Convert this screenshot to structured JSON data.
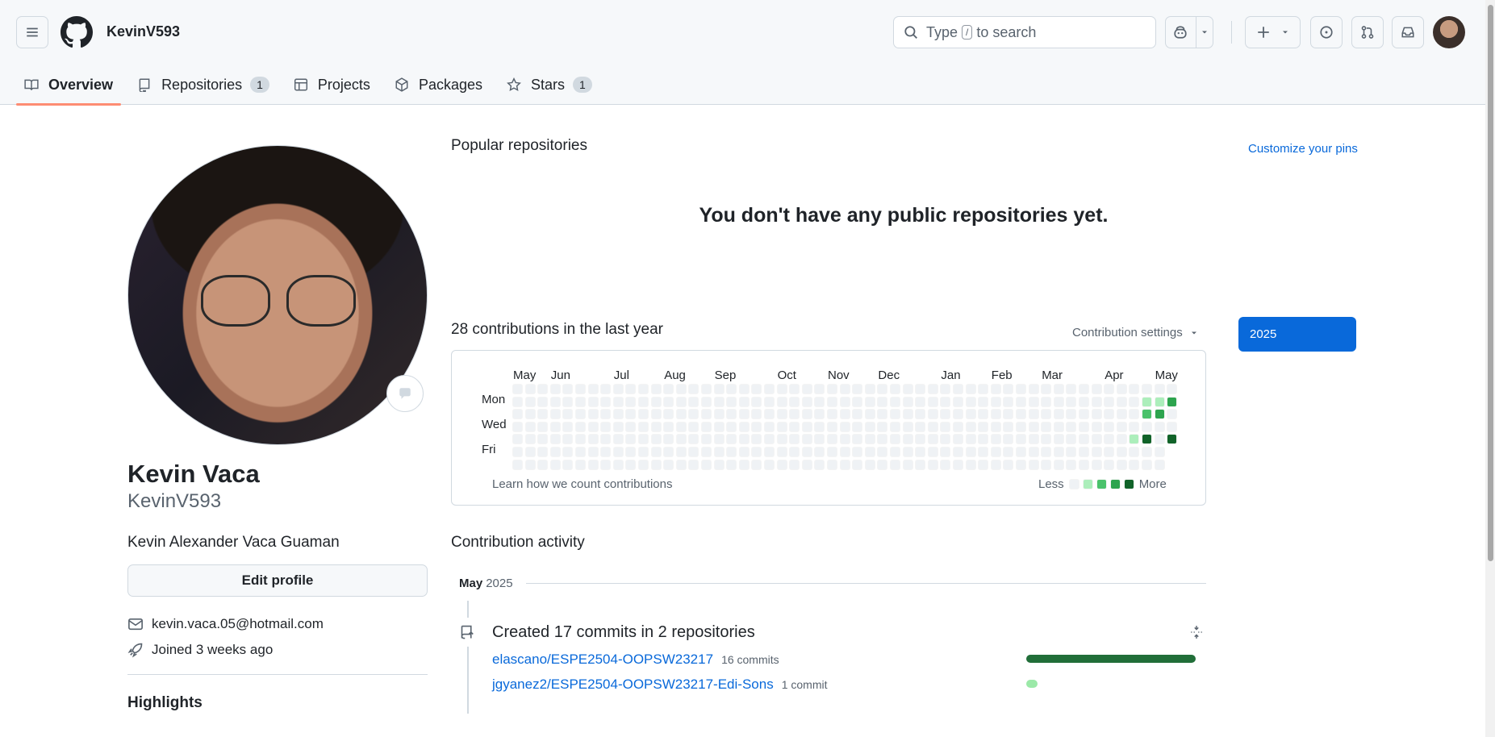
{
  "header": {
    "username": "KevinV593",
    "search_prefix": "Type",
    "search_key": "/",
    "search_suffix": "to search",
    "tabs": [
      {
        "label": "Overview",
        "count": ""
      },
      {
        "label": "Repositories",
        "count": "1"
      },
      {
        "label": "Projects",
        "count": ""
      },
      {
        "label": "Packages",
        "count": ""
      },
      {
        "label": "Stars",
        "count": "1"
      }
    ]
  },
  "profile": {
    "full_name": "Kevin Vaca",
    "login": "KevinV593",
    "bio": "Kevin Alexander Vaca Guaman",
    "edit_label": "Edit profile",
    "email": "kevin.vaca.05@hotmail.com",
    "joined": "Joined 3 weeks ago",
    "highlights": "Highlights"
  },
  "popular": {
    "title": "Popular repositories",
    "customize": "Customize your pins",
    "empty": "You don't have any public repositories yet."
  },
  "contributions": {
    "title": "28 contributions in the last year",
    "settings": "Contribution settings",
    "year": "2025",
    "months": [
      "May",
      "Jun",
      "Jul",
      "Aug",
      "Sep",
      "Oct",
      "Nov",
      "Dec",
      "Jan",
      "Feb",
      "Mar",
      "Apr",
      "May"
    ],
    "days": [
      "Mon",
      "Wed",
      "Fri"
    ],
    "learn": "Learn how we count contributions",
    "less": "Less",
    "more": "More",
    "level_colors": [
      "#eff2f5",
      "#aceebb",
      "#4ac26b",
      "#2da44e",
      "#116329"
    ],
    "active_cells": [
      {
        "week": 50,
        "day": 1,
        "level": 1
      },
      {
        "week": 51,
        "day": 1,
        "level": 1
      },
      {
        "week": 52,
        "day": 1,
        "level": 3
      },
      {
        "week": 50,
        "day": 2,
        "level": 2
      },
      {
        "week": 51,
        "day": 2,
        "level": 3
      },
      {
        "week": 49,
        "day": 4,
        "level": 1
      },
      {
        "week": 50,
        "day": 4,
        "level": 4
      },
      {
        "week": 52,
        "day": 4,
        "level": 4
      }
    ]
  },
  "activity": {
    "title": "Contribution activity",
    "month": "May",
    "year": "2025",
    "summary": "Created 17 commits in 2 repositories",
    "repos": [
      {
        "name": "elascano/ESPE2504-OOPSW23217",
        "commits": "16 commits",
        "share": 1.0,
        "color": "#216e39"
      },
      {
        "name": "jgyanez2/ESPE2504-OOPSW23217-Edi-Sons",
        "commits": "1 commit",
        "share": 0.0625,
        "color": "#9be9a8"
      }
    ]
  }
}
